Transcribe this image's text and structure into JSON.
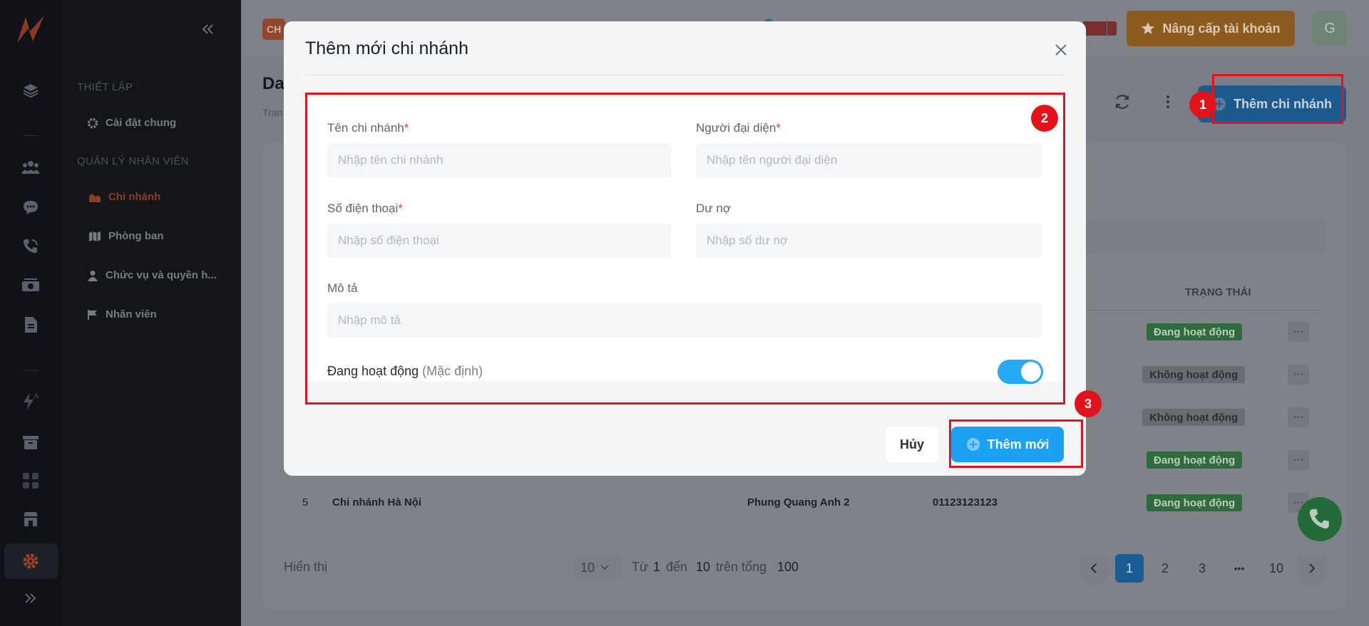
{
  "sidebar": {
    "sections": [
      {
        "label": "THIẾT LẬP",
        "items": [
          {
            "label": "Cài đặt chung",
            "icon": "gear-icon"
          }
        ]
      },
      {
        "label": "QUẢN LÝ NHÂN VIÊN",
        "items": [
          {
            "label": "Chi nhánh",
            "icon": "branch-icon",
            "active": true
          },
          {
            "label": "Phòng ban",
            "icon": "map-icon"
          },
          {
            "label": "Chức vụ và quyền h...",
            "icon": "user-icon"
          },
          {
            "label": "Nhân viên",
            "icon": "flag-icon"
          }
        ]
      }
    ],
    "rail_icons": [
      "logo-icon",
      "layers-icon",
      "users-icon",
      "chat-icon",
      "phone-icon",
      "money-icon",
      "document-icon",
      "automation-icon",
      "archive-icon",
      "apps-icon",
      "store-icon",
      "settings-icon",
      "expand-icon"
    ]
  },
  "header": {
    "badge": "CH",
    "upgrade_label": "Nâng cấp tài khoản",
    "avatar_initial": "G"
  },
  "page": {
    "title": "Da",
    "breadcrumb": "Tran",
    "add_button_label": "Thêm chi nhánh",
    "table": {
      "status_header": "TRẠNG THÁI",
      "statuses": [
        "Đang hoạt động",
        "Không hoạt động",
        "Không hoạt động",
        "Đang hoạt động",
        "Đang hoạt động"
      ],
      "row5": {
        "index": "5",
        "name": "Chi nhánh Hà Nội",
        "representative": "Phung Quang Anh 2",
        "phone": "01123123123"
      }
    },
    "pagination": {
      "show_label": "Hiển thị",
      "page_size": "10",
      "from_label": "Từ",
      "from": "1",
      "to_label": "đến",
      "to": "10",
      "total_label": "trên tổng",
      "total": "100",
      "pages": [
        "1",
        "2",
        "3",
        "•••",
        "10"
      ],
      "current": "1"
    }
  },
  "modal": {
    "title": "Thêm mới chi nhánh",
    "fields": {
      "branch_name": {
        "label": "Tên chi nhánh",
        "required": "*",
        "placeholder": "Nhập tên chi nhánh"
      },
      "representative": {
        "label": "Người đại diện",
        "required": "*",
        "placeholder": "Nhập tên người đại diện"
      },
      "phone": {
        "label": "Số điện thoại",
        "required": "*",
        "placeholder": "Nhập số điện thoại"
      },
      "debt": {
        "label": "Dư nợ",
        "placeholder": "Nhập số dư nợ"
      },
      "description": {
        "label": "Mô tả",
        "placeholder": "Nhập mô tả"
      }
    },
    "active_toggle": {
      "label": "Đang hoạt động",
      "hint": "(Mặc định)",
      "on": true
    },
    "cancel_label": "Hủy",
    "submit_label": "Thêm mới"
  },
  "annotations": {
    "step1": "1",
    "step2": "2",
    "step3": "3",
    "color": "#e3131b"
  }
}
